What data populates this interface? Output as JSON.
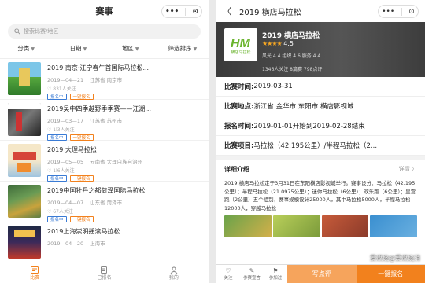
{
  "left": {
    "title": "赛事",
    "capsule": {
      "more": "•••",
      "close": "⊙"
    },
    "search_placeholder": "搜索比赛/地区",
    "filters": [
      "分类",
      "日期",
      "地区",
      "筛选排序"
    ],
    "events": [
      {
        "title": "2019 南京·江宁春牛首国际马拉松...",
        "date": "2019—04—21",
        "place": "江苏省 南京市",
        "likes": "831人关注",
        "tags": [
          "报名中",
          "一键报名"
        ]
      },
      {
        "title": "2019吴中四季越野季季赛——江湖...",
        "date": "2019—03—17",
        "place": "江苏省 苏州市",
        "likes": "1l3人关注",
        "tags": [
          "报名中",
          "一键报名"
        ]
      },
      {
        "title": "2019 大理马拉松",
        "date": "2019—05—05",
        "place": "云南省 大理白族自治州",
        "likes": "1l6人关注",
        "tags": [
          "报名中",
          "一键报名"
        ]
      },
      {
        "title": "2019中国牡丹之都荷泽国际马拉松",
        "date": "2019—04—07",
        "place": "山东省 菏泽市",
        "likes": "67人关注",
        "tags": [
          "报名中",
          "一键报名"
        ]
      },
      {
        "title": "2019上海崇明摇滚马拉松",
        "date": "2019—04—20",
        "place": "上海市",
        "likes": "",
        "tags": [
          "报名中",
          "一键报名"
        ]
      }
    ],
    "tabbar": [
      "比赛",
      "已报名",
      "我的"
    ]
  },
  "right": {
    "title": "2019 横店马拉松",
    "capsule": {
      "more": "•••",
      "close": "⊙"
    },
    "hero": {
      "logo_text": "横店马拉松",
      "name": "2019 横店马拉松",
      "stars": "★★★★",
      "score": "4.5",
      "sub": "风光 4.4  组织 4.6  服务 4.4",
      "counts": "1346人关注  8篇赛  798点评"
    },
    "rows": [
      {
        "key": "比赛时间:",
        "value": "2019-03-31"
      },
      {
        "key": "比赛地点:",
        "value": "浙江省 金华市 东阳市 横店影视城"
      },
      {
        "key": "报名时间:",
        "value": "2019-01-01开始到2019-02-28结束"
      },
      {
        "key": "比赛项目:",
        "value": "马拉松（42.195公里）/半程马拉松（2..."
      }
    ],
    "detail_label": "详细介绍",
    "detail_more": "详情 〉",
    "description": "2019 横店马拉松定于3月31日在东阳横店影视城举行。赛事设分：马拉松（42.195公里）；半程马拉松（21.0975公里）；迷你马拉松（6公里）；欢乐跑（6公里）；皇宫跑（2公里）五个组别，赛事规模设计25000人，其中马拉松5000人，半程马拉松12000人，穿越马拉松",
    "actions": [
      "关注",
      "参赛宣言",
      "参加过"
    ],
    "btn_review": "写点评",
    "btn_signup": "一键报名",
    "watermark": "爱燃烧@爱燃烧消"
  },
  "colors": {
    "accent": "#f2811d",
    "blue_tag": "#3a7bd5",
    "star": "#f5a623"
  }
}
